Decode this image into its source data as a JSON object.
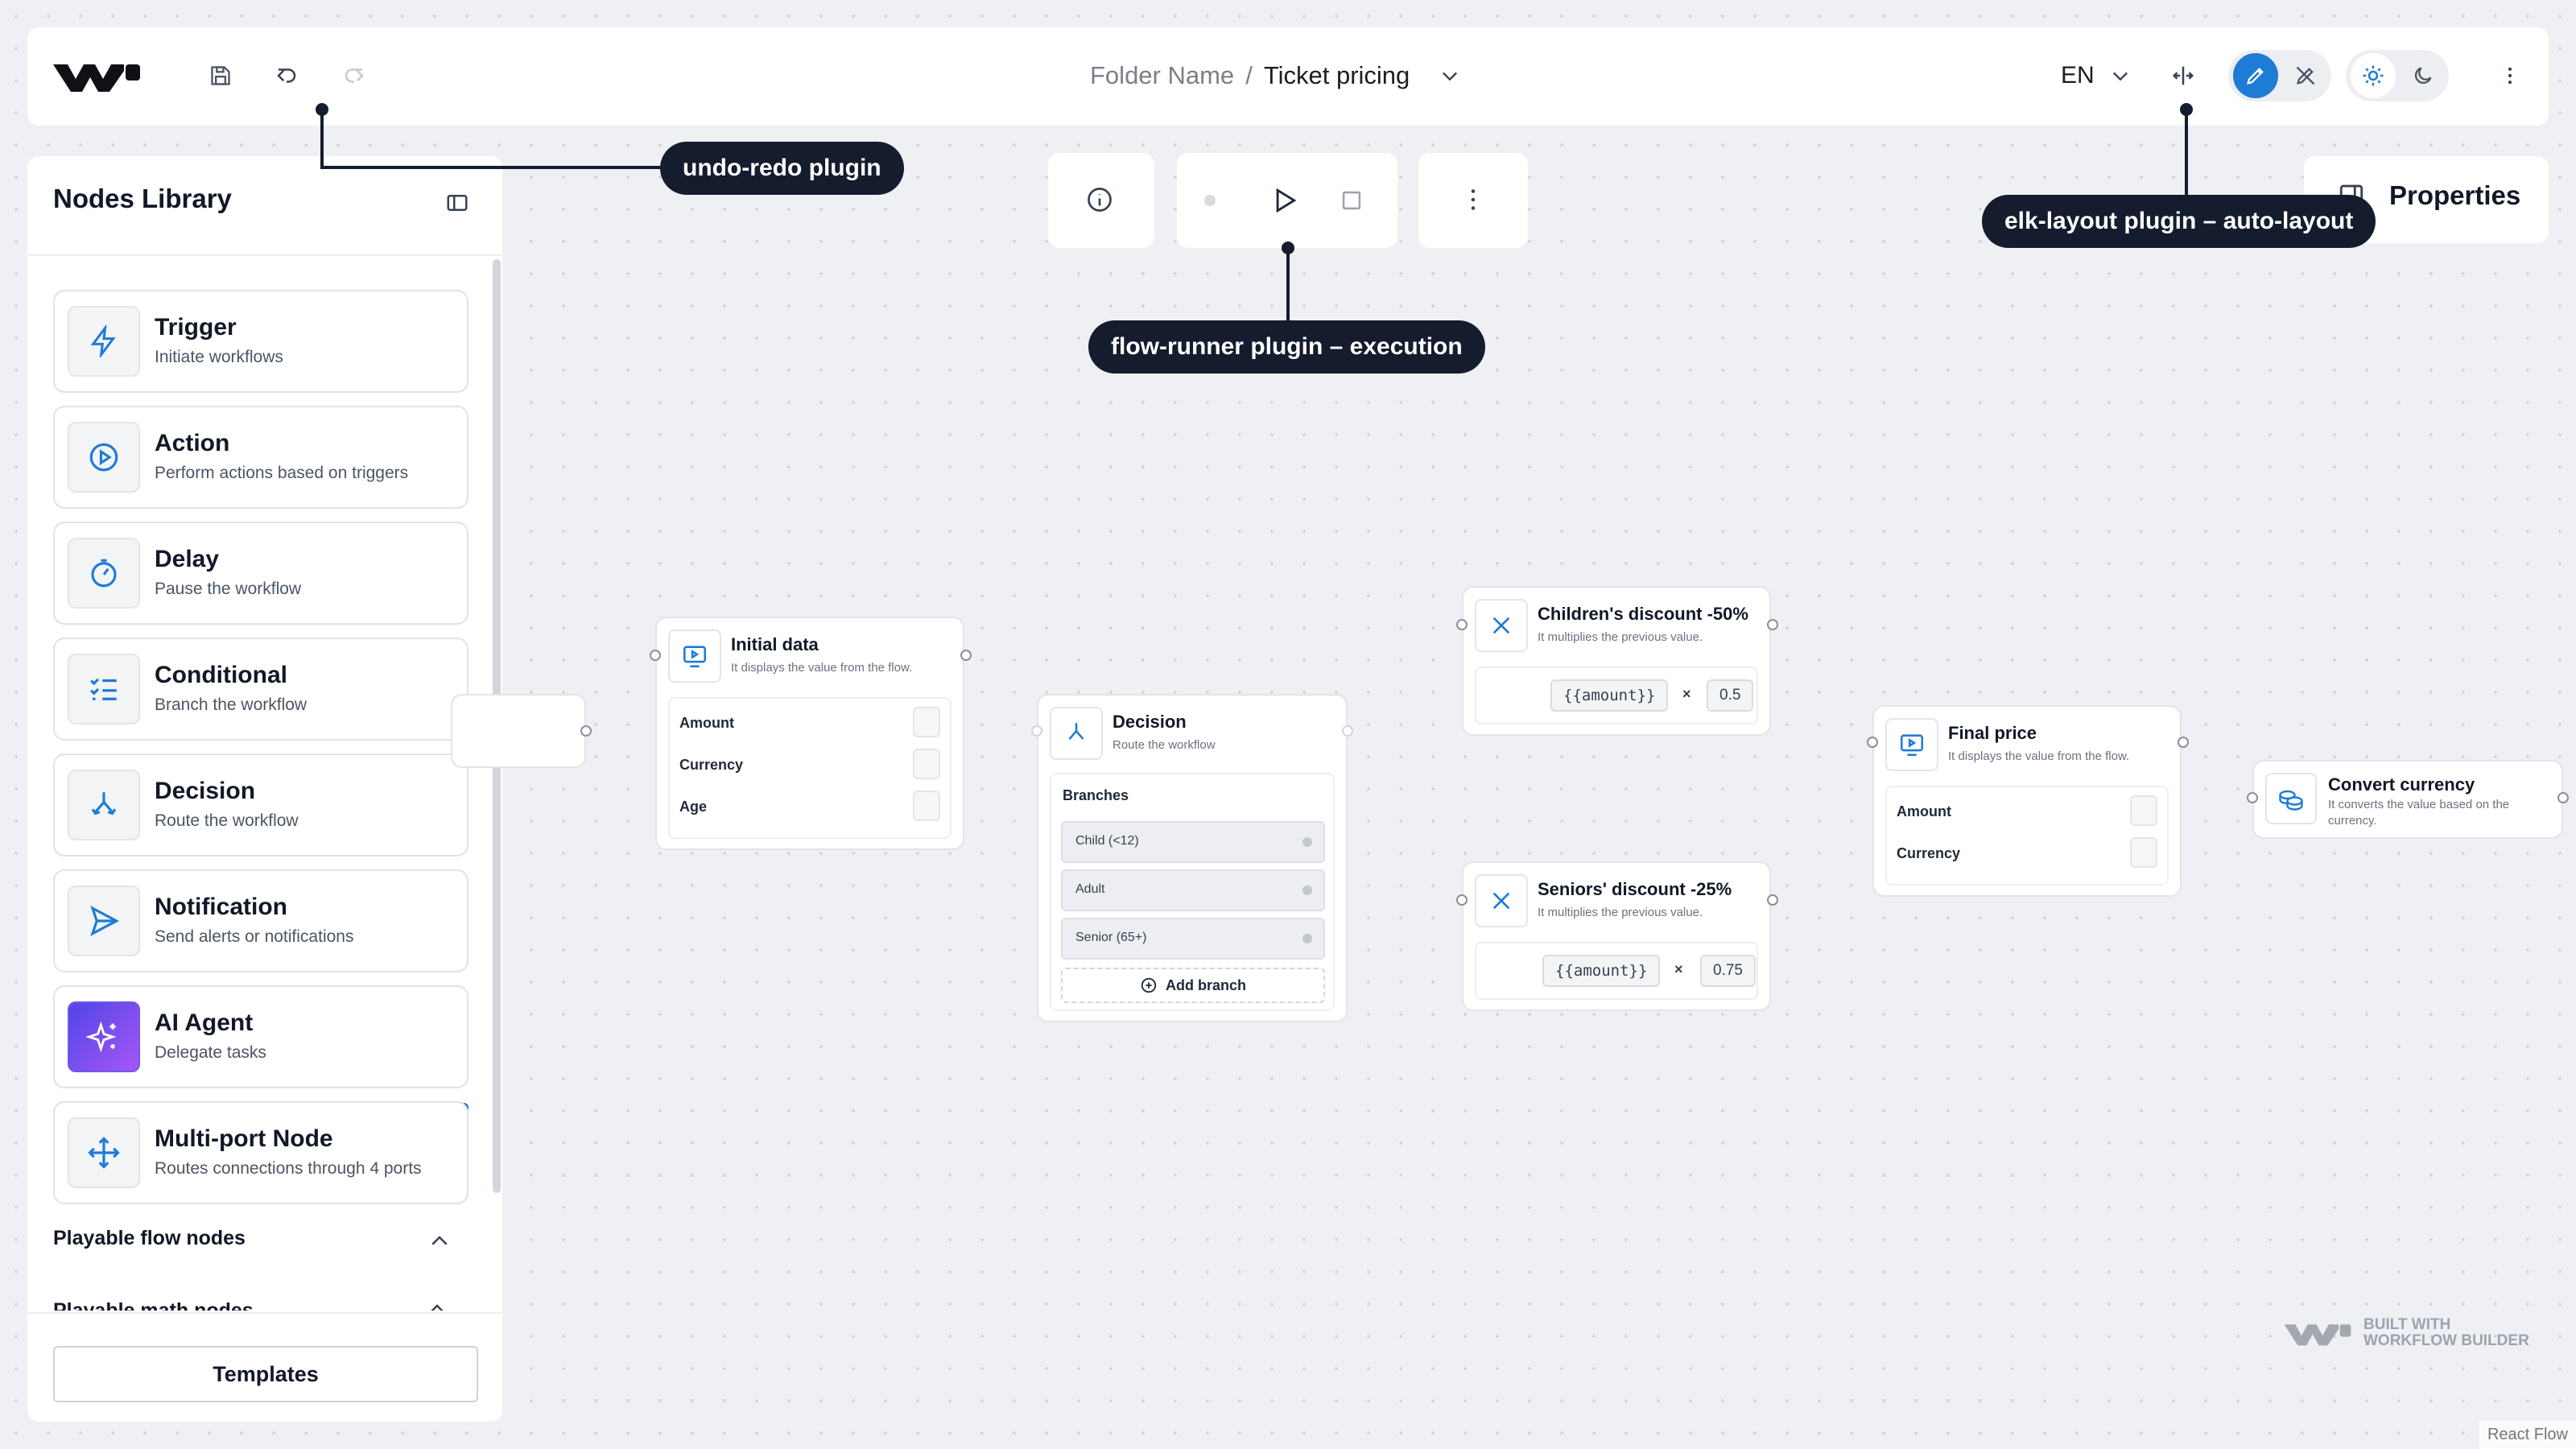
{
  "topbar": {
    "breadcrumb_folder": "Folder Name",
    "breadcrumb_sep": "/",
    "breadcrumb_title": "Ticket pricing",
    "language": "EN"
  },
  "sidebar": {
    "title": "Nodes Library",
    "items": [
      {
        "name": "Trigger",
        "desc": "Initiate workflows",
        "icon": "bolt-icon"
      },
      {
        "name": "Action",
        "desc": "Perform actions based on triggers",
        "icon": "play-circle-icon"
      },
      {
        "name": "Delay",
        "desc": "Pause the workflow",
        "icon": "timer-icon"
      },
      {
        "name": "Conditional",
        "desc": "Branch the workflow",
        "icon": "list-check-icon"
      },
      {
        "name": "Decision",
        "desc": "Route the workflow",
        "icon": "split-icon"
      },
      {
        "name": "Notification",
        "desc": "Send alerts or notifications",
        "icon": "send-icon"
      },
      {
        "name": "AI Agent",
        "desc": "Delegate tasks",
        "icon": "sparkles-icon"
      },
      {
        "name": "Multi-port Node",
        "desc": "Routes connections through 4 ports",
        "icon": "arrows-move-icon"
      }
    ],
    "section_playable": "Playable flow nodes",
    "section_math": "Playable math nodes",
    "templates_label": "Templates"
  },
  "properties_title": "Properties",
  "callouts": {
    "undo_redo": "undo-redo plugin",
    "flow_runner": "flow-runner plugin – execution",
    "elk_layout": "elk-layout plugin – auto-layout"
  },
  "nodes": {
    "initial_data": {
      "title": "Initial data",
      "subtitle": "It displays the value from the flow.",
      "rows": [
        "Amount",
        "Currency",
        "Age"
      ]
    },
    "decision": {
      "title": "Decision",
      "subtitle": "Route the workflow",
      "branches_label": "Branches",
      "branches": [
        "Child (<12)",
        "Adult",
        "Senior (65+)"
      ],
      "add_branch": "Add branch"
    },
    "children_discount": {
      "title": "Children's discount -50%",
      "subtitle": "It multiplies the previous value.",
      "expr": "{{amount}}",
      "op": "×",
      "factor": "0.5"
    },
    "seniors_discount": {
      "title": "Seniors' discount -25%",
      "subtitle": "It multiplies the previous value.",
      "expr": "{{amount}}",
      "op": "×",
      "factor": "0.75"
    },
    "final_price": {
      "title": "Final price",
      "subtitle": "It displays the value from the flow.",
      "rows": [
        "Amount",
        "Currency"
      ]
    },
    "convert_currency": {
      "title": "Convert currency",
      "subtitle": "It converts the value based on the currency."
    }
  },
  "brand": {
    "line1": "BUILT WITH",
    "line2": "WORKFLOW BUILDER"
  },
  "attribution": "React Flow",
  "colors": {
    "accent": "#1e7bd6",
    "callout": "#141c2e",
    "ai_gradient_start": "#4f46e5",
    "ai_gradient_end": "#a855f7",
    "drop_indicator": "#2155d6"
  }
}
